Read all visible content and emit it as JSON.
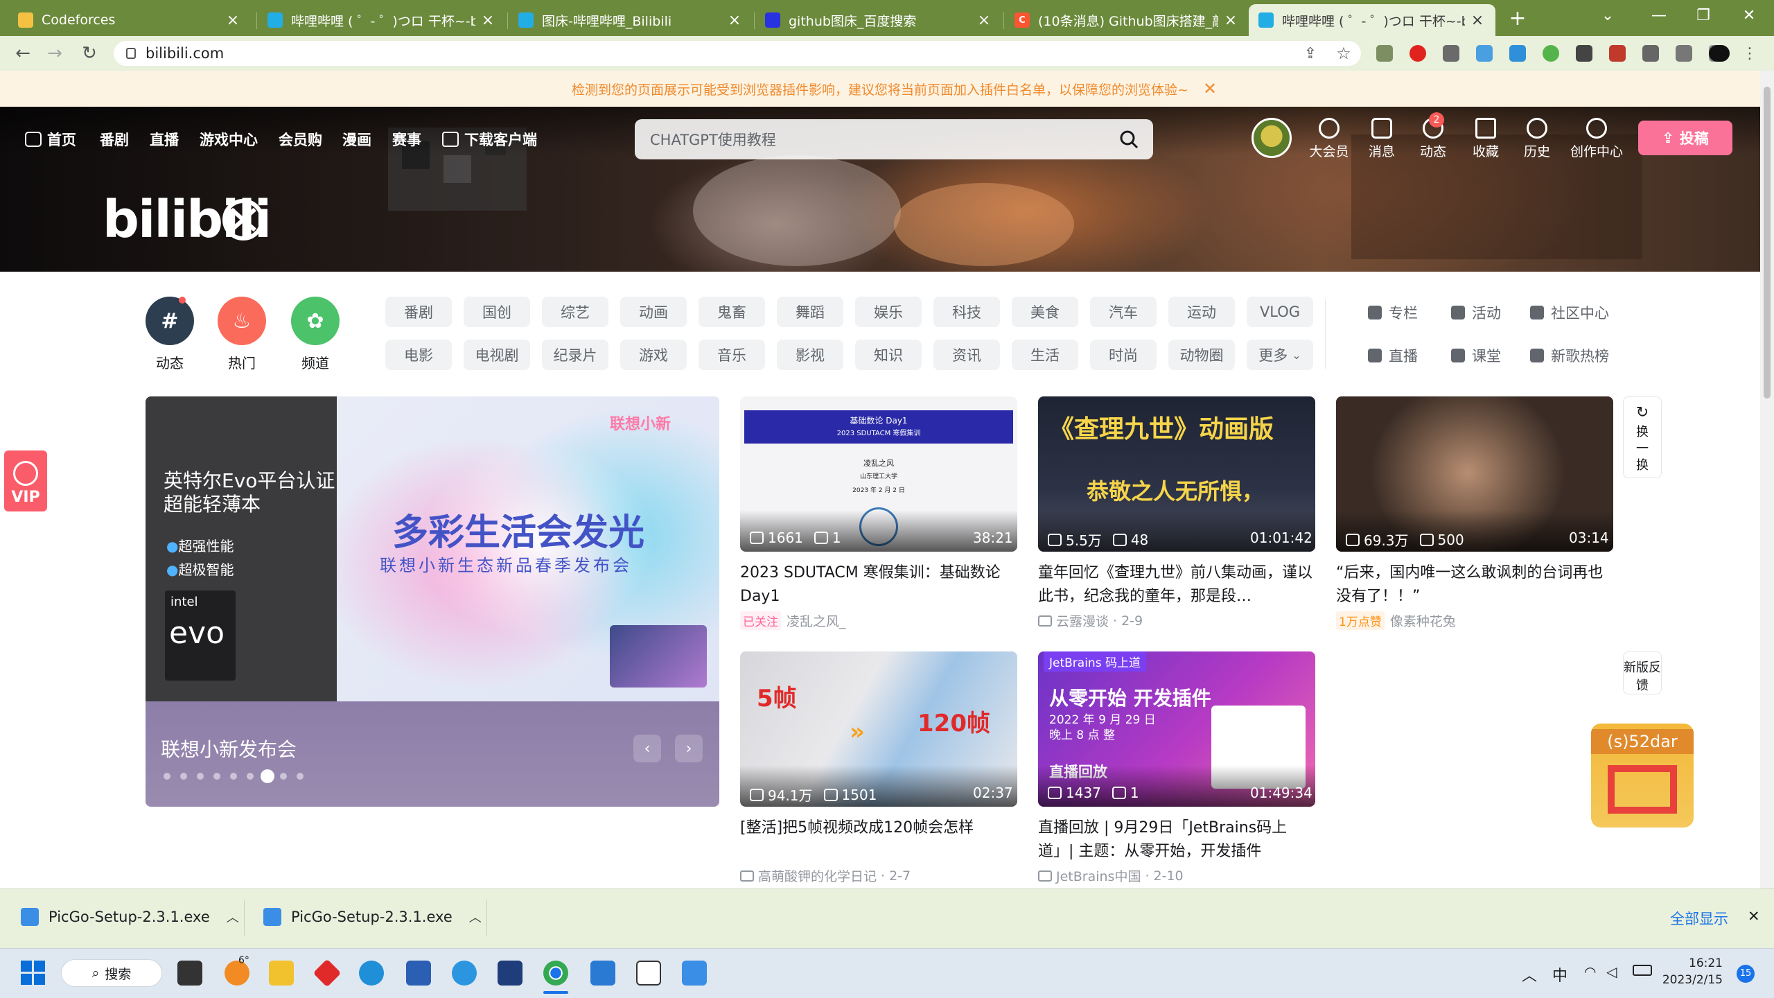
{
  "browser": {
    "tabs": [
      {
        "title": "Codeforces",
        "favicon": "codeforces-icon",
        "active": false
      },
      {
        "title": "哔哩哔哩 ( ゜- ゜)つロ 干杯~-bili",
        "favicon": "bilibili-icon",
        "active": false
      },
      {
        "title": "图床-哔哩哔哩_Bilibili",
        "favicon": "bilibili-icon",
        "active": false
      },
      {
        "title": "github图床_百度搜索",
        "favicon": "baidu-icon",
        "active": false
      },
      {
        "title": "(10条消息) Github图床搭建_敲",
        "favicon": "csdn-icon",
        "active": false
      },
      {
        "title": "哔哩哔哩 ( ゜- ゜)つロ 干杯~-bili",
        "favicon": "bilibili-icon",
        "active": true
      }
    ],
    "new_tab": "+",
    "url": "bilibili.com",
    "accent_color": "#6b8a3c"
  },
  "warning": {
    "text": "检测到您的页面展示可能受到浏览器插件影响，建议您将当前页面加入插件白名单，以保障您的浏览体验~",
    "close": "✕"
  },
  "header": {
    "nav": [
      "首页",
      "番剧",
      "直播",
      "游戏中心",
      "会员购",
      "漫画",
      "赛事",
      "下载客户端"
    ],
    "search_placeholder": "CHATGPT使用教程",
    "logo": "bilibili",
    "icons": [
      "大会员",
      "消息",
      "动态",
      "收藏",
      "历史",
      "创作中心"
    ],
    "badge": "2",
    "upload": "投稿"
  },
  "channels": {
    "big": [
      {
        "label": "动态",
        "color": "#2c3e50"
      },
      {
        "label": "热门",
        "color": "#fb6b5b"
      },
      {
        "label": "频道",
        "color": "#4cc26a"
      }
    ],
    "row1": [
      "番剧",
      "国创",
      "综艺",
      "动画",
      "鬼畜",
      "舞蹈",
      "娱乐",
      "科技",
      "美食",
      "汽车",
      "运动",
      "VLOG"
    ],
    "row2": [
      "电影",
      "电视剧",
      "纪录片",
      "游戏",
      "音乐",
      "影视",
      "知识",
      "资讯",
      "生活",
      "时尚",
      "动物圈",
      "更多"
    ],
    "side": [
      "专栏",
      "活动",
      "社区中心",
      "直播",
      "课堂",
      "新歌热榜"
    ]
  },
  "carousel": {
    "left_title": "英特尔Evo平台认证",
    "left_title2": "超能轻薄本",
    "bullet1": "超强性能",
    "bullet2": "超极智能",
    "intel": "intel",
    "evo": "evo",
    "brand": "联想小新",
    "headline": "多彩生活会发光",
    "subline": "联想小新生态新品春季发布会",
    "caption": "联想小新发布会",
    "dots": 9,
    "active_dot": 6
  },
  "videos": [
    {
      "views": "1661",
      "danmaku": "1",
      "duration": "38:21",
      "title": "2023 SDUTACM 寒假集训：基础数论 Day1",
      "tag": "已关注",
      "author": "凌乱之风_",
      "date": ""
    },
    {
      "views": "5.5万",
      "danmaku": "48",
      "duration": "01:01:42",
      "title": "童年回忆《查理九世》前八集动画，谨以此书，纪念我的童年，那是段…",
      "tag": "",
      "author": "云露漫谈",
      "date": "2-9",
      "overlay": "《查理九世》动画版",
      "overlay2": "恭敬之人无所惧，"
    },
    {
      "views": "69.3万",
      "danmaku": "500",
      "duration": "03:14",
      "title": "“后来，国内唯一这么敢讽刺的台词再也没有了！！”",
      "tag": "1万点赞",
      "author": "像素种花兔",
      "date": ""
    },
    {
      "views": "94.1万",
      "danmaku": "1501",
      "duration": "02:37",
      "title": "[整活]把5帧视频改成120帧会怎样",
      "tag": "",
      "author": "高萌酸钾的化学日记",
      "date": "2-7",
      "overlay": "5帧",
      "overlay2": "120帧"
    },
    {
      "views": "1437",
      "danmaku": "1",
      "duration": "01:49:34",
      "title": "直播回放 | 9月29日「JetBrains码上道」| 主题：从零开始，开发插件",
      "tag": "",
      "author": "JetBrains中国",
      "date": "2-10",
      "overlay": "JetBrains 码上道",
      "overlay2": "从零开始 开发插件",
      "overlay3": "2022 年 9 月 29 日",
      "overlay4": "晚上 8 点 整",
      "overlay5": "直播回放"
    }
  ],
  "slide1": {
    "line1": "基础数论 Day1",
    "line2": "2023 SDUTACM 寒假集训",
    "line3": "凌乱之风",
    "line4": "山东理工大学",
    "line5": "2023 年 2 月 2 日"
  },
  "float": {
    "refresh": "换一换",
    "feedback": "新版反馈",
    "vip_float": "(s)52dar",
    "vip_left": "VIP"
  },
  "downloads": {
    "items": [
      "PicGo-Setup-2.3.1.exe",
      "PicGo-Setup-2.3.1.exe"
    ],
    "show_all": "全部显示",
    "close": "✕"
  },
  "taskbar": {
    "search": "搜索",
    "weather": "6°",
    "ime": "中",
    "time": "16:21",
    "date": "2023/2/15",
    "notif": "15"
  }
}
